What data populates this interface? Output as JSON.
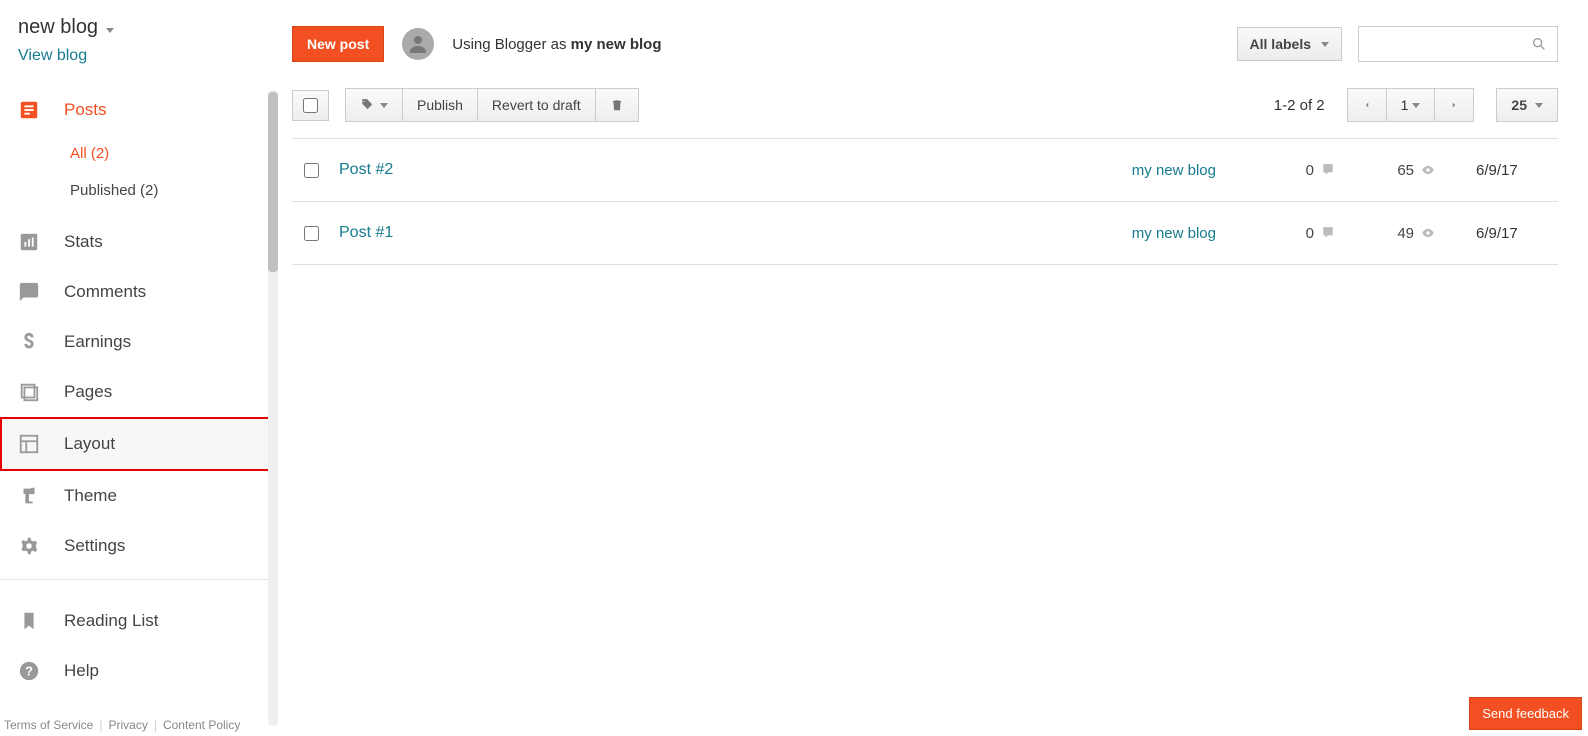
{
  "blog": {
    "name": "new blog",
    "view_link": "View blog"
  },
  "sidebar": {
    "items": [
      {
        "id": "posts",
        "label": "Posts"
      },
      {
        "id": "stats",
        "label": "Stats"
      },
      {
        "id": "comments",
        "label": "Comments"
      },
      {
        "id": "earnings",
        "label": "Earnings"
      },
      {
        "id": "pages",
        "label": "Pages"
      },
      {
        "id": "layout",
        "label": "Layout"
      },
      {
        "id": "theme",
        "label": "Theme"
      },
      {
        "id": "settings",
        "label": "Settings"
      },
      {
        "id": "reading-list",
        "label": "Reading List"
      },
      {
        "id": "help",
        "label": "Help"
      }
    ],
    "sub_posts": [
      {
        "id": "all",
        "label": "All (2)"
      },
      {
        "id": "published",
        "label": "Published (2)"
      }
    ]
  },
  "footer": {
    "terms": "Terms of Service",
    "privacy": "Privacy",
    "content": "Content Policy"
  },
  "header": {
    "new_post": "New post",
    "using_prefix": "Using Blogger as ",
    "using_name": "my new blog",
    "labels_dd": "All labels"
  },
  "toolbar": {
    "publish": "Publish",
    "revert": "Revert to draft",
    "page_range": "1-2 of 2",
    "page_current": "1",
    "per_page": "25"
  },
  "posts": [
    {
      "title": "Post #2",
      "author": "my new blog",
      "comments": "0",
      "views": "65",
      "date": "6/9/17"
    },
    {
      "title": "Post #1",
      "author": "my new blog",
      "comments": "0",
      "views": "49",
      "date": "6/9/17"
    }
  ],
  "feedback": "Send feedback"
}
